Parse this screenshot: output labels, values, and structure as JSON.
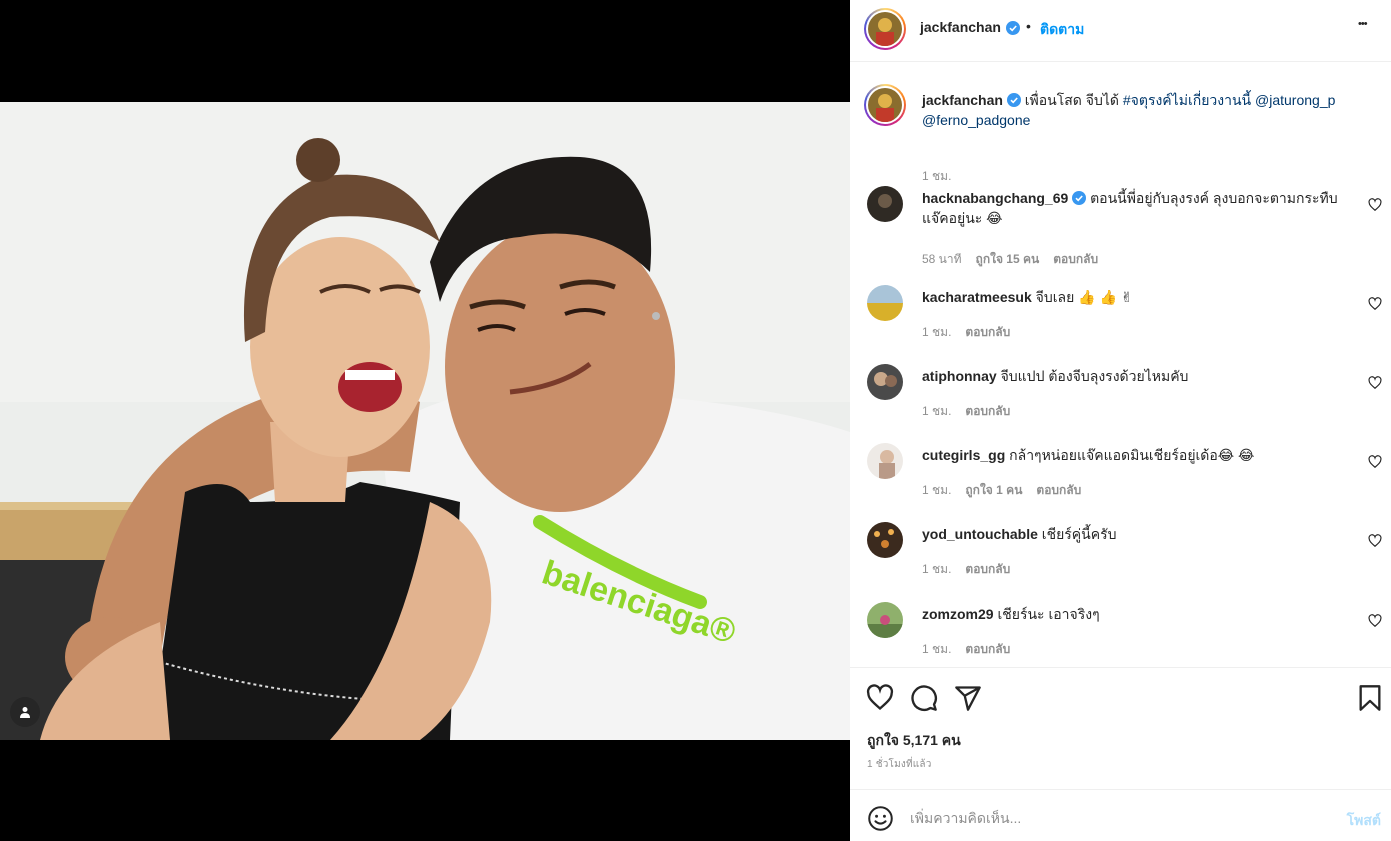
{
  "post": {
    "author": "jackfanchan",
    "separator": "•",
    "follow_label": "ติดตาม",
    "more_label": "•••",
    "caption_text": "เพื่อนโสด จีบได้",
    "caption_hashtag": "#จตุรงค์ไม่เกี่ยวงานนี้",
    "caption_mention1": "@jaturong_p",
    "caption_mention2": "@ferno_padgone",
    "caption_time": "1 ชม."
  },
  "comments": [
    {
      "user": "hacknabangchang_69",
      "verified": true,
      "text": "ตอนนี้พี่อยู่กับลุงรงค์ ลุงบอกจะตามกระทืบแจ๊คอยู่นะ 😂",
      "time": "58 นาที",
      "likes": "ถูกใจ 15 คน",
      "reply": "ตอบกลับ"
    },
    {
      "user": "kacharatmeesuk",
      "verified": false,
      "text": "จีบเลย 👍 👍 ✌",
      "time": "1 ชม.",
      "likes": "",
      "reply": "ตอบกลับ"
    },
    {
      "user": "atiphonnay",
      "verified": false,
      "text": "จีบแปป ต้องจีบลุงรงด้วยไหมคับ",
      "time": "1 ชม.",
      "likes": "",
      "reply": "ตอบกลับ"
    },
    {
      "user": "cutegirls_gg",
      "verified": false,
      "text": "กล้าๆหน่อยแจ๊คแอดมินเชียร์อยู่เด้อ😂 😂",
      "time": "1 ชม.",
      "likes": "ถูกใจ 1 คน",
      "reply": "ตอบกลับ"
    },
    {
      "user": "yod_untouchable",
      "verified": false,
      "text": "เชียร์คู่นี้ครับ",
      "time": "1 ชม.",
      "likes": "",
      "reply": "ตอบกลับ"
    },
    {
      "user": "zomzom29",
      "verified": false,
      "text": "เชียร์นะ เอาจริงๆ",
      "time": "1 ชม.",
      "likes": "",
      "reply": "ตอบกลับ"
    }
  ],
  "footer": {
    "likes_label": "ถูกใจ 5,171 คน",
    "time_ago": "1 ชั่วโมงที่แล้ว",
    "comment_placeholder": "เพิ่มความคิดเห็น...",
    "post_label": "โพสต์"
  },
  "icons": {
    "verified": "verified-badge-icon",
    "heart": "heart-icon",
    "comment": "comment-icon",
    "share": "share-icon",
    "save": "bookmark-icon",
    "emoji": "emoji-icon",
    "user_tag": "user-tag-icon",
    "more": "more-options-icon"
  },
  "colors": {
    "accent": "#0095f6",
    "verified": "#3897f0",
    "shirt_print": "#8fd62a",
    "muted_text": "#8e8e8e"
  }
}
